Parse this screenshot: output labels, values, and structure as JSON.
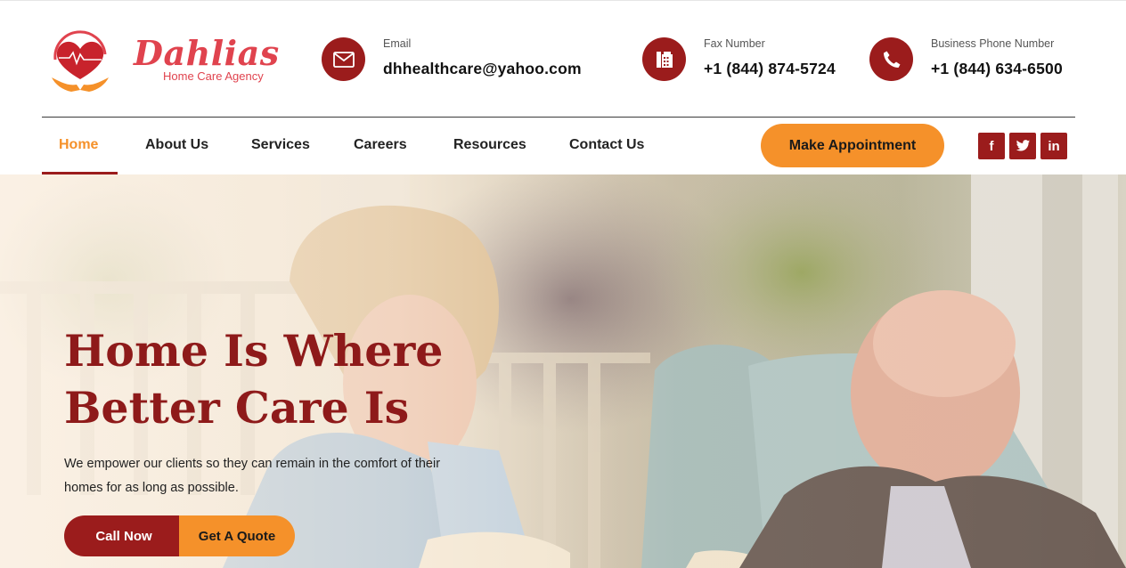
{
  "brand": {
    "name": "Dahlias",
    "tagline": "Home Care Agency"
  },
  "contacts": {
    "email": {
      "label": "Email",
      "value": "dhhealthcare@yahoo.com",
      "icon": "envelope-icon"
    },
    "fax": {
      "label": "Fax Number",
      "value": "+1 (844) 874-5724",
      "icon": "fax-icon"
    },
    "phone": {
      "label": "Business Phone Number",
      "value": "+1 (844) 634-6500",
      "icon": "phone-icon"
    }
  },
  "nav": {
    "items": [
      {
        "label": "Home",
        "active": true
      },
      {
        "label": "About Us"
      },
      {
        "label": "Services"
      },
      {
        "label": "Careers"
      },
      {
        "label": "Resources"
      },
      {
        "label": "Contact Us"
      }
    ],
    "cta": "Make Appointment"
  },
  "social": {
    "facebook": "f",
    "linkedin": "in"
  },
  "hero": {
    "title_line1": "Home Is Where",
    "title_line2": "Better Care Is",
    "text": "We empower our clients so they can remain in the comfort of their homes for as long as possible.",
    "primary_button": "Call Now",
    "secondary_button": "Get A Quote"
  },
  "colors": {
    "brand_red": "#9b1c1c",
    "accent_orange": "#f5912a",
    "logo_red": "#e0434e"
  }
}
